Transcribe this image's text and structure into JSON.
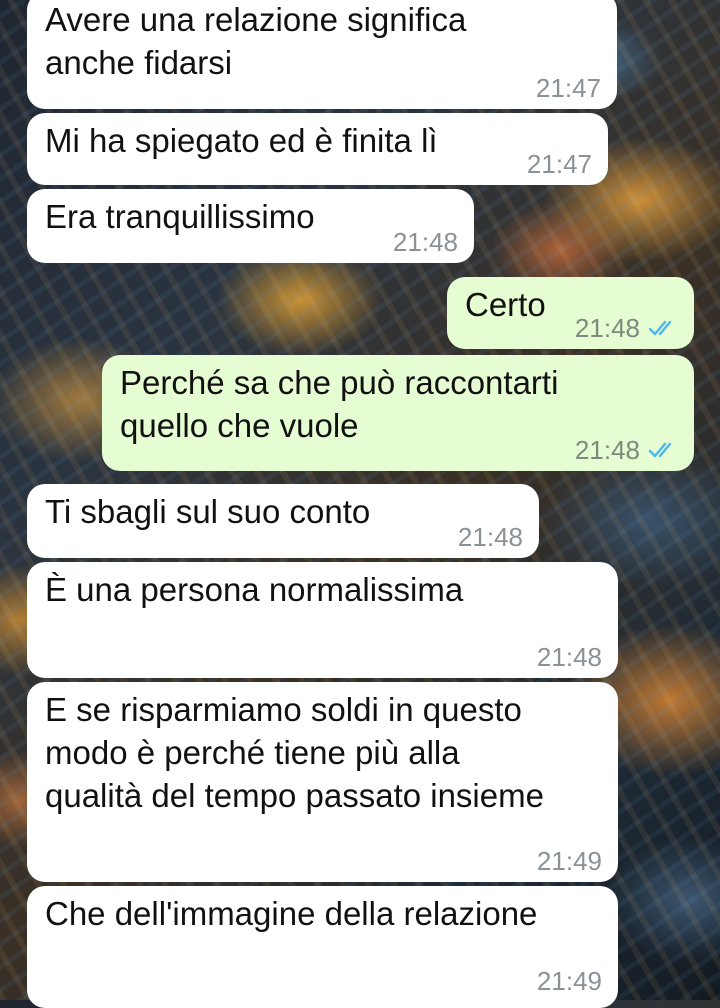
{
  "messages": [
    {
      "direction": "incoming",
      "text": "Avere una relazione significa\nanche fidarsi",
      "time": "21:47"
    },
    {
      "direction": "incoming",
      "text": "Mi ha spiegato ed è finita lì",
      "time": "21:47"
    },
    {
      "direction": "incoming",
      "text": "Era tranquillissimo",
      "time": "21:48"
    },
    {
      "direction": "outgoing",
      "text": "Certo",
      "time": "21:48",
      "status_icon": "double-check-read-icon"
    },
    {
      "direction": "outgoing",
      "text": "Perché sa che può raccontarti\nquello che vuole",
      "time": "21:48",
      "status_icon": "double-check-read-icon"
    },
    {
      "direction": "incoming",
      "text": "Ti sbagli sul suo conto",
      "time": "21:48"
    },
    {
      "direction": "incoming",
      "text": "È una persona normalissima",
      "time": "21:48"
    },
    {
      "direction": "incoming",
      "text": "E se risparmiamo soldi in questo\nmodo è perché tiene più alla\nqualità del tempo passato insieme",
      "time": "21:49"
    },
    {
      "direction": "incoming",
      "text": "Che dell'immagine della relazione",
      "time": "21:49"
    }
  ],
  "colors": {
    "incoming_bubble": "#ffffff",
    "outgoing_bubble": "#e6fdd3",
    "read_ticks": "#4fb6ec",
    "timestamp": "#8a9197"
  }
}
